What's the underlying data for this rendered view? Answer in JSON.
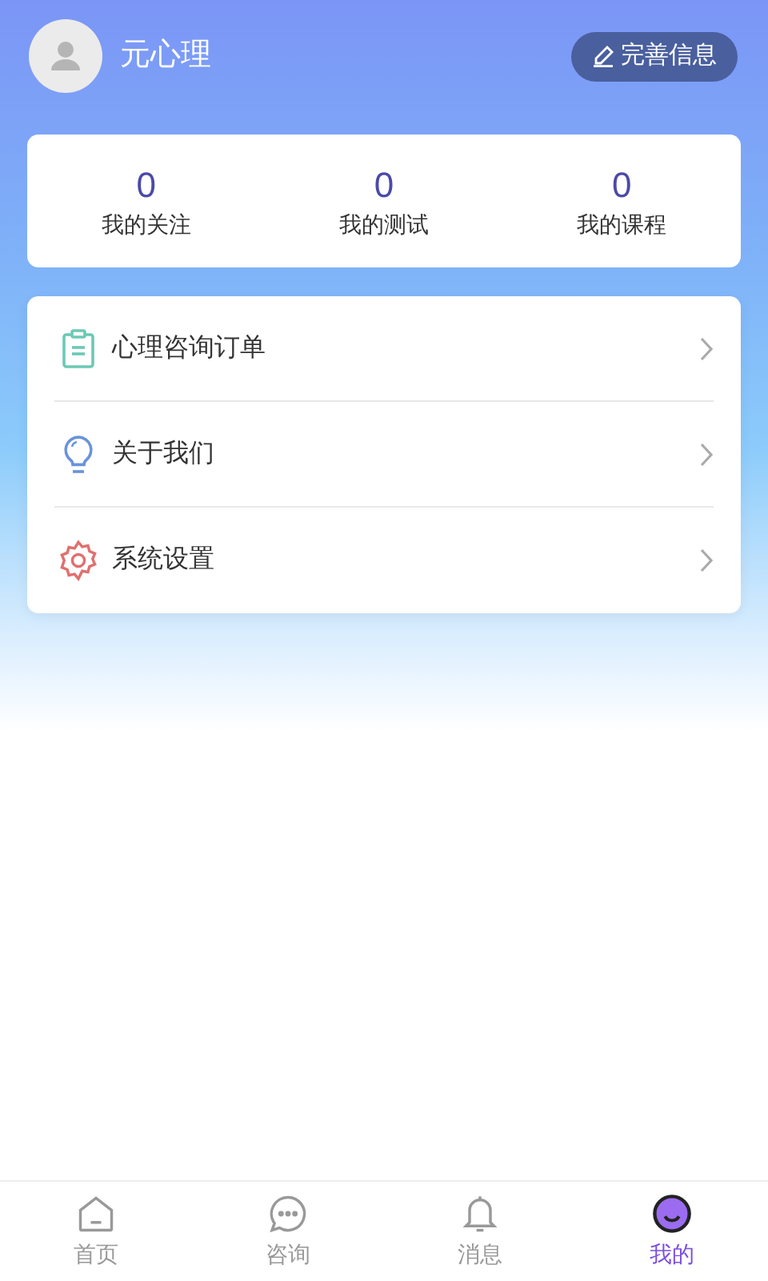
{
  "profile": {
    "name": "元心理",
    "edit_button": "完善信息"
  },
  "stats": [
    {
      "value": "0",
      "label": "我的关注"
    },
    {
      "value": "0",
      "label": "我的测试"
    },
    {
      "value": "0",
      "label": "我的课程"
    }
  ],
  "menu": [
    {
      "kind": "clipboard",
      "label": "心理咨询订单"
    },
    {
      "kind": "bulb",
      "label": "关于我们"
    },
    {
      "kind": "gear",
      "label": "系统设置"
    }
  ],
  "tabs": [
    {
      "kind": "home",
      "label": "首页",
      "selected": false
    },
    {
      "kind": "chat",
      "label": "咨询",
      "selected": false
    },
    {
      "kind": "bell",
      "label": "消息",
      "selected": false
    },
    {
      "kind": "me",
      "label": "我的",
      "selected": true
    }
  ]
}
